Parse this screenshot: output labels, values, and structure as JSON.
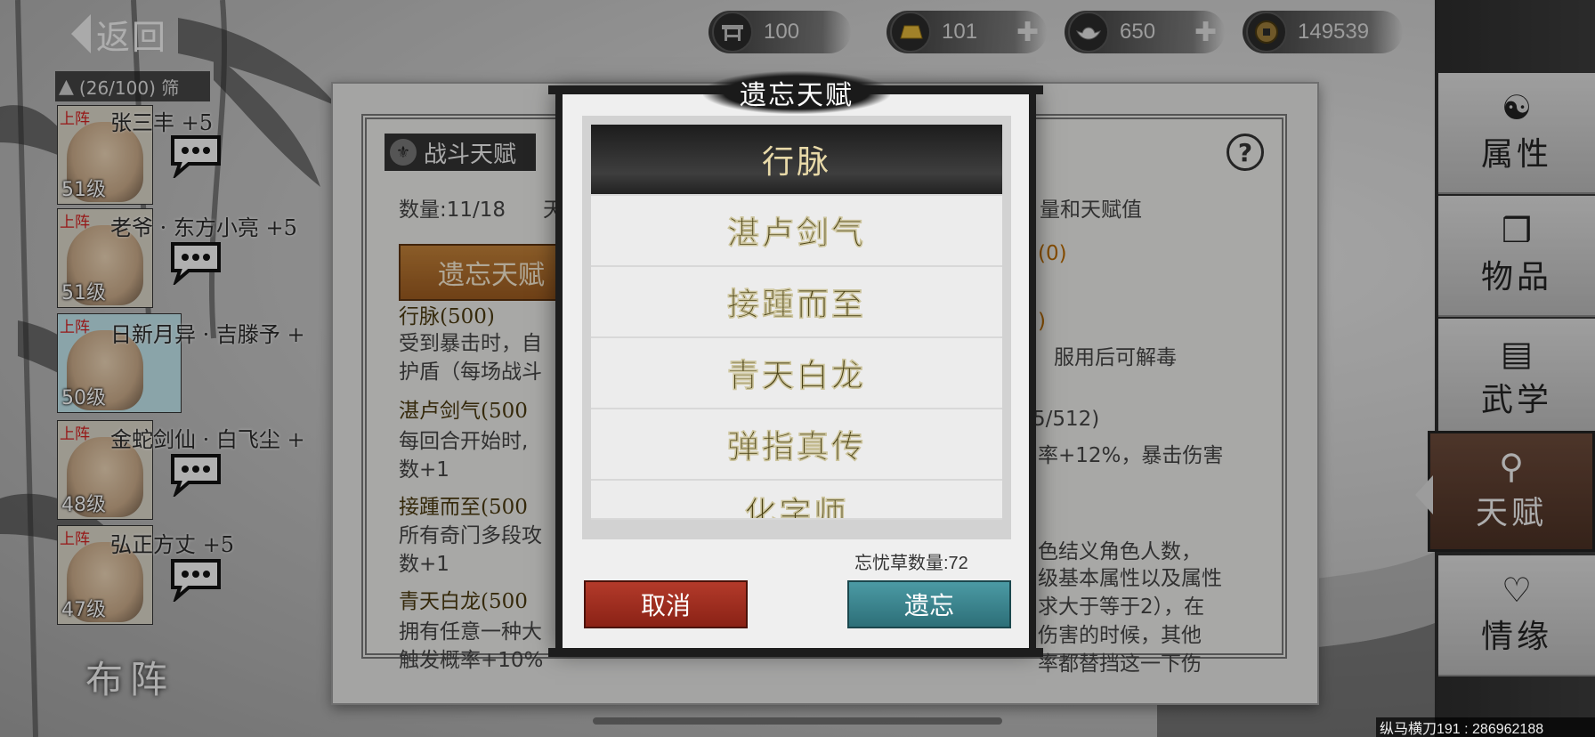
{
  "nav": {
    "back_label": "返回"
  },
  "resources": [
    {
      "icon": "stamina-icon",
      "value": "100",
      "plus": false
    },
    {
      "icon": "gold-bar-icon",
      "value": "101",
      "plus": true
    },
    {
      "icon": "silver-ingot-icon",
      "value": "650",
      "plus": true
    },
    {
      "icon": "coin-icon",
      "value": "149539",
      "plus": false
    }
  ],
  "roster": {
    "header": "(26/100) 筛",
    "heroes": [
      {
        "tag": "上阵",
        "name": "张三丰  +5",
        "level": "51级"
      },
      {
        "tag": "上阵",
        "name": "老爷 · 东方小亮  +5",
        "level": "51级"
      },
      {
        "tag": "上阵",
        "name": "日新月异 · 吉滕予  +",
        "level": "50级"
      },
      {
        "tag": "上阵",
        "name": "金蛇剑仙 · 白飞尘  +",
        "level": "48级"
      },
      {
        "tag": "上阵",
        "name": "弘正方丈  +5",
        "level": "47级"
      }
    ],
    "formation_label": "布阵"
  },
  "panel": {
    "tab_title": "战斗天赋",
    "count_text": "数量:11/18",
    "count_tail": "天",
    "right_header": "量和天赋值",
    "forget_button": "遗忘天赋",
    "left_lines": [
      "行脉(500)",
      "受到暴击时，自",
      "护盾（每场战斗",
      "湛卢剑气(500",
      "每回合开始时,",
      "数+1",
      "接踵而至(500",
      "所有奇门多段攻",
      "数+1",
      "青天白龙(500",
      "拥有任意一种大",
      "触发概率+10%"
    ],
    "right_lines": [
      "(0)",
      ")",
      "服用后可解毒",
      "5/512)",
      "率+12%，暴击伤害",
      "色结义角色人数，",
      "级基本属性以及属性",
      "求大于等于2），在",
      "伤害的时候，其他",
      "率都替挡这一下伤"
    ]
  },
  "sidebar": {
    "items": [
      {
        "icon": "attribute-icon",
        "label": "属性"
      },
      {
        "icon": "item-icon",
        "label": "物品"
      },
      {
        "icon": "martial-icon",
        "label": "武学"
      },
      {
        "icon": "talent-icon",
        "label": "天赋"
      },
      {
        "icon": "bond-icon",
        "label": "情缘"
      }
    ],
    "active": "天赋"
  },
  "modal": {
    "title": "遗忘天赋",
    "options": [
      "行脉",
      "湛卢剑气",
      "接踵而至",
      "青天白龙",
      "弹指真传",
      "化字师"
    ],
    "selected": "行脉",
    "herb_count_text": "忘忧草数量:72",
    "cancel_label": "取消",
    "confirm_label": "遗忘"
  },
  "footer_id": "纵马横刀191 : 286962188"
}
